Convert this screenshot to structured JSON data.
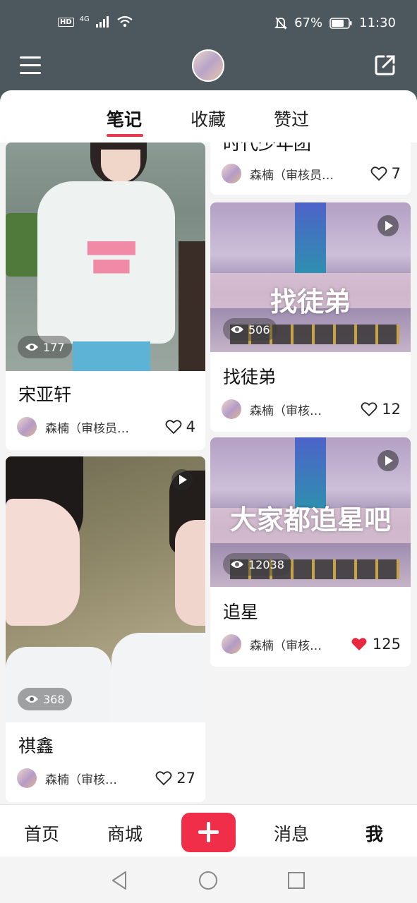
{
  "status_bar": {
    "network": "4G",
    "hd": "HD",
    "battery": "67%",
    "time": "11:30"
  },
  "colors": {
    "header": "#4d585e",
    "accent": "#e83a4b",
    "plus": "#f02e4a"
  },
  "tabs": [
    {
      "label": "笔记",
      "active": true
    },
    {
      "label": "收藏",
      "active": false
    },
    {
      "label": "赞过",
      "active": false
    }
  ],
  "cards": {
    "top_right": {
      "partial_title": "时代少年团",
      "author": "森楠（审核员…",
      "likes": "7"
    },
    "card1": {
      "title": "宋亚轩",
      "views": "177",
      "author": "森楠（审核员…",
      "likes": "4"
    },
    "card2": {
      "title": "找徒弟",
      "overlay": "找徒弟",
      "views": "506",
      "author": "森楠（审核…",
      "likes": "12"
    },
    "card3": {
      "title": "追星",
      "overlay": "大家都追星吧",
      "views": "12038",
      "author": "森楠（审核…",
      "likes": "125",
      "liked": true
    },
    "card4": {
      "title": "祺鑫",
      "views": "368",
      "author": "森楠（审核…",
      "likes": "27"
    }
  },
  "bottom_nav": {
    "home": "首页",
    "shop": "商城",
    "messages": "消息",
    "me": "我"
  }
}
